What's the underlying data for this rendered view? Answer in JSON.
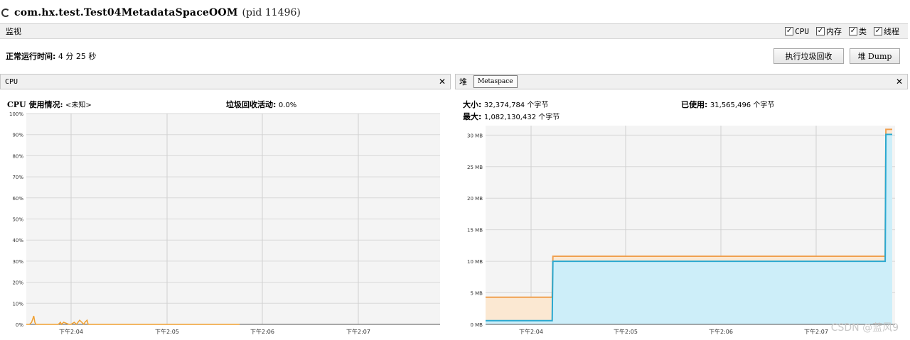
{
  "window": {
    "app_name": "com.hx.test.Test04MetadataSpaceOOM",
    "pid_text": "(pid 11496)"
  },
  "monitor": {
    "label": "监视",
    "checkboxes": [
      {
        "label": "CPU",
        "checked": true
      },
      {
        "label": "内存",
        "checked": true
      },
      {
        "label": "类",
        "checked": true
      },
      {
        "label": "线程",
        "checked": true
      }
    ]
  },
  "uptime": {
    "label": "正常运行时间:",
    "value": "4 分 25 秒"
  },
  "buttons": {
    "gc": "执行垃圾回收",
    "dump": "堆 Dump"
  },
  "cpu_panel": {
    "title": "CPU",
    "usage_label": "CPU 使用情况:",
    "usage_value": "<未知>",
    "gc_label": "垃圾回收活动:",
    "gc_value": "0.0%"
  },
  "memory_panel": {
    "tabs": [
      "堆",
      "Metaspace"
    ],
    "selected_tab": "Metaspace",
    "size_label": "大小:",
    "size_value": "32,374,784 个字节",
    "used_label": "已使用:",
    "used_value": "31,565,496 个字节",
    "max_label": "最大:",
    "max_value": "1,082,130,432 个字节"
  },
  "watermark": "CSDN @蓝风9",
  "colors": {
    "cpu_line": "#f0a030",
    "size_line": "#f0a050",
    "size_fill": "#fbe8d2",
    "used_line": "#2aa8d0",
    "used_fill": "#cdeef9"
  },
  "chart_data": [
    {
      "type": "line",
      "name": "cpu",
      "y_ticks": [
        "0%",
        "10%",
        "20%",
        "30%",
        "40%",
        "50%",
        "60%",
        "70%",
        "80%",
        "90%",
        "100%"
      ],
      "x_ticks": [
        "下午2:04",
        "下午2:05",
        "下午2:06",
        "下午2:07"
      ],
      "ylim": [
        0,
        100
      ],
      "series": [
        {
          "x": [
            0,
            3,
            5,
            7,
            8,
            9,
            12,
            30,
            32,
            33,
            35,
            40,
            42,
            45,
            47,
            50,
            52,
            54,
            55,
            57,
            58,
            60,
            62,
            200
          ],
          "values": [
            0,
            0,
            1,
            4,
            1,
            0,
            0,
            0,
            1,
            0,
            1,
            0,
            0,
            1,
            0,
            2,
            1,
            0,
            1,
            2,
            0,
            0,
            0,
            0
          ]
        }
      ]
    },
    {
      "type": "area",
      "name": "metaspace",
      "y_ticks": [
        "0 MB",
        "5 MB",
        "10 MB",
        "15 MB",
        "20 MB",
        "25 MB",
        "30 MB"
      ],
      "x_ticks": [
        "下午2:04",
        "下午2:05",
        "下午2:06",
        "下午2:07"
      ],
      "ylim": [
        0,
        31.5
      ],
      "series": [
        {
          "x": [
            0,
            95,
            96,
            570,
            571,
            580
          ],
          "values": [
            4.3,
            4.3,
            10.8,
            10.8,
            30.9,
            30.9
          ]
        },
        {
          "x": [
            0,
            95,
            96,
            570,
            571,
            580
          ],
          "values": [
            0.6,
            0.6,
            10.0,
            10.0,
            30.1,
            30.1
          ]
        }
      ]
    }
  ]
}
